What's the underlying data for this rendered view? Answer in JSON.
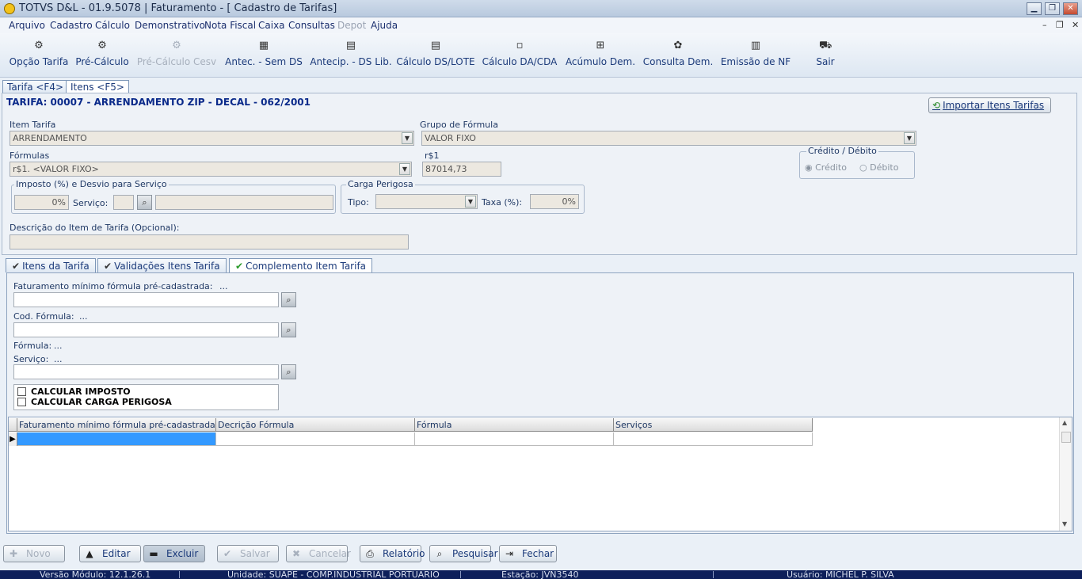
{
  "window": {
    "title": "TOTVS D&L - 01.9.5078 | Faturamento - [ Cadastro de Tarifas]",
    "min": "▁",
    "restore": "❐",
    "close": "✕"
  },
  "menu": [
    "Arquivo",
    "Cadastro",
    "Cálculo",
    "Demonstrativo",
    "Nota Fiscal",
    "Caixa",
    "Consultas",
    "Depot",
    "Ajuda"
  ],
  "mdi_controls": [
    "–",
    "❐",
    "✕"
  ],
  "toolbar": [
    {
      "label": "Opção Tarifa",
      "icon": "options-icon",
      "glyph": "⚙"
    },
    {
      "label": "Pré-Cálculo",
      "icon": "precalc-icon",
      "glyph": "⚙"
    },
    {
      "label": "Pré-Cálculo Cesv",
      "icon": "precalc-cesv-icon",
      "glyph": "⚙"
    },
    {
      "label": "Antec. - Sem DS",
      "icon": "advance-icon",
      "glyph": "▦"
    },
    {
      "label": "Antecip. - DS Lib.",
      "icon": "calculator-icon",
      "glyph": "▤"
    },
    {
      "label": "Cálculo DS/LOTE",
      "icon": "calculator-icon",
      "glyph": "▤"
    },
    {
      "label": "Cálculo DA/CDA",
      "icon": "window-icon",
      "glyph": "▫"
    },
    {
      "label": "Acúmulo Dem.",
      "icon": "document-add-icon",
      "glyph": "⊞"
    },
    {
      "label": "Consulta Dem.",
      "icon": "query-icon",
      "glyph": "✿"
    },
    {
      "label": "Emissão de NF",
      "icon": "invoice-icon",
      "glyph": "▥"
    },
    {
      "label": "Sair",
      "icon": "exit-icon",
      "glyph": "⛟"
    }
  ],
  "tabs_top": [
    "Tarifa <F4>",
    "Itens <F5>"
  ],
  "tarifa_header": "TARIFA: 00007 - ARRENDAMENTO ZIP - DECAL - 062/2001",
  "import_button": "Importar Itens Tarifas",
  "form": {
    "item_tarifa_label": "Item Tarifa",
    "item_tarifa_value": "ARRENDAMENTO",
    "grupo_label": "Grupo de Fórmula",
    "grupo_value": "VALOR FIXO",
    "formulas_label": "Fórmulas",
    "formulas_value": "r$1. <VALOR FIXO>",
    "r1_label": "r$1",
    "r1_value": "87014,73",
    "credito_debito_title": "Crédito / Débito",
    "credito_label": "Crédito",
    "debito_label": "Débito",
    "imposto_title": "Imposto (%) e Desvio para Serviço",
    "imposto_value": "0%",
    "servico_label": "Serviço:",
    "carga_title": "Carga Perigosa",
    "tipo_label": "Tipo:",
    "taxa_label": "Taxa (%):",
    "taxa_value": "0%",
    "descricao_label": "Descrição do Item de Tarifa (Opcional):"
  },
  "tabs_detail": [
    "Itens da Tarifa",
    "Validações Itens Tarifa",
    "Complemento Item Tarifa"
  ],
  "detail": {
    "fat_min_label": "Faturamento mínimo fórmula pré-cadastrada:",
    "fat_min_dots": "...",
    "cod_formula_label": "Cod. Fórmula:",
    "cod_formula_dots": "...",
    "formula_label": "Fórmula:",
    "formula_dots": "...",
    "servico_label": "Serviço:",
    "servico_dots": "...",
    "calc_imposto": "CALCULAR IMPOSTO",
    "calc_carga": "CALCULAR CARGA PERIGOSA"
  },
  "grid": {
    "columns": [
      "Faturamento mínimo fórmula pré-cadastrada",
      "Decrição Fórmula",
      "Fórmula",
      "Serviços"
    ]
  },
  "buttons": [
    {
      "label": "Novo",
      "icon": "plus-icon",
      "glyph": "✚",
      "enabled": false
    },
    {
      "label": "Editar",
      "icon": "edit-icon",
      "glyph": "▲",
      "enabled": true
    },
    {
      "label": "Excluir",
      "icon": "delete-icon",
      "glyph": "▬",
      "enabled": true
    },
    {
      "label": "Salvar",
      "icon": "check-icon",
      "glyph": "✔",
      "enabled": false
    },
    {
      "label": "Cancelar",
      "icon": "cancel-icon",
      "glyph": "✖",
      "enabled": false
    },
    {
      "label": "Relatório",
      "icon": "print-icon",
      "glyph": "⎙",
      "enabled": true
    },
    {
      "label": "Pesquisar",
      "icon": "search-icon",
      "glyph": "⌕",
      "enabled": true
    },
    {
      "label": "Fechar",
      "icon": "close-door-icon",
      "glyph": "⇥",
      "enabled": true
    }
  ],
  "status": {
    "versao": "Versão Módulo: 12.1.26.1",
    "unidade": "Unidade: SUAPE - COMP.INDUSTRIAL PORTUARIO",
    "estacao": "Estação: JVN3540",
    "usuario": "Usuário: MICHEL P. SILVA"
  }
}
